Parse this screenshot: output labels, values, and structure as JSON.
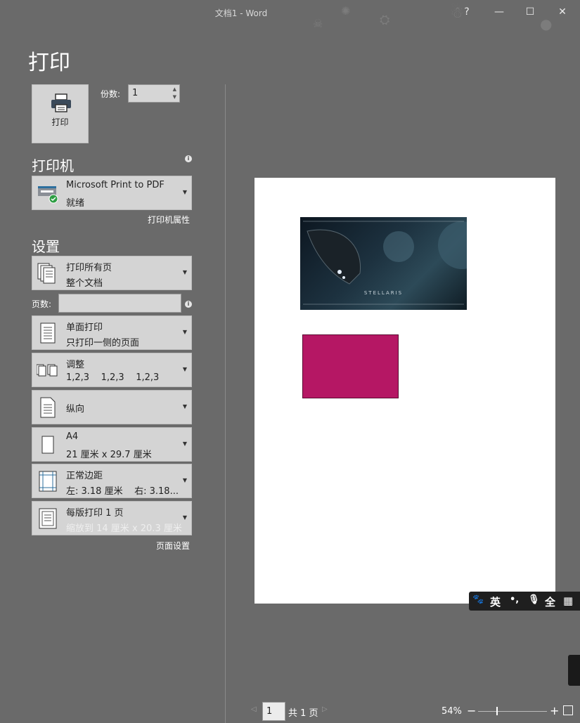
{
  "window": {
    "title": "文档1 - Word",
    "help_label": "?",
    "minimize_label": "—",
    "maximize_label": "☐",
    "close_label": "✕"
  },
  "page": {
    "heading": "打印"
  },
  "print": {
    "button_label": "打印",
    "copies_label": "份数:",
    "copies_value": "1"
  },
  "printer": {
    "section_title": "打印机",
    "name": "Microsoft Print to PDF",
    "status": "就绪",
    "properties_link": "打印机属性"
  },
  "settings": {
    "section_title": "设置",
    "range": {
      "line1": "打印所有页",
      "line2": "整个文档"
    },
    "pages_label": "页数:",
    "pages_value": "",
    "sides": {
      "line1": "单面打印",
      "line2": "只打印一侧的页面"
    },
    "collate": {
      "line1": "调整",
      "line2": "1,2,3    1,2,3    1,2,3"
    },
    "orientation": {
      "line1": "纵向"
    },
    "paper": {
      "line1": "A4",
      "line2": "21 厘米 x 29.7 厘米"
    },
    "margins": {
      "line1": "正常边距",
      "line2": "左: 3.18 厘米    右: 3.18..."
    },
    "per_sheet": {
      "line1": "每版打印 1 页",
      "line2": "缩放到 14 厘米 x 20.3 厘米"
    },
    "page_setup_link": "页面设置"
  },
  "preview": {
    "image_caption": "STELLARIS",
    "shape_color": "#b51764"
  },
  "ime": {
    "paw": "🐾",
    "lang": "英",
    "punct": "•,",
    "mic": "🎙",
    "width": "全",
    "grid": "▦"
  },
  "bottom": {
    "current_page": "1",
    "total_pages": "共 1 页",
    "zoom": "54%",
    "zoom_level": 0.54
  }
}
